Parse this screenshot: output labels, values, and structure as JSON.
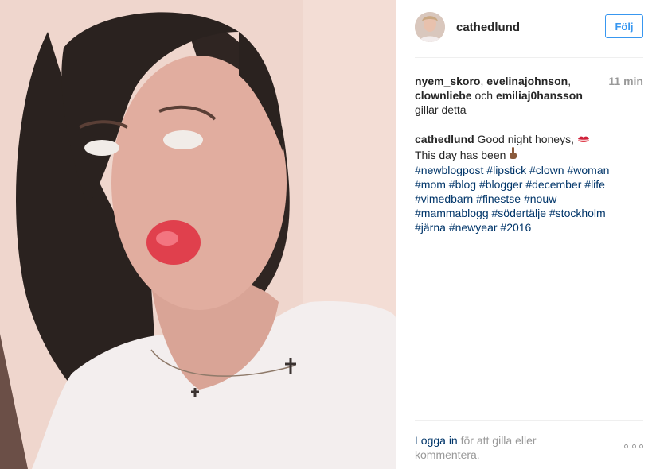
{
  "post": {
    "image_alt": "selfie-photo",
    "owner": "cathedlund",
    "follow_label": "Följ",
    "likes": {
      "users": [
        "nyem_skoro",
        "evelinajohnson",
        "clownliebe",
        "emiliaj0hansson"
      ],
      "separator": ", ",
      "conjunction": " och ",
      "suffix": "gillar detta"
    },
    "time_ago": "11 min",
    "caption": {
      "user": "cathedlund",
      "line1": " Good night honeys, ",
      "line2": "This day has been ",
      "hashtags": [
        "#newblogpost",
        "#lipstick",
        "#clown",
        "#woman",
        "#mom",
        "#blog",
        "#blogger",
        "#december",
        "#life",
        "#vimedbarn",
        "#finestse",
        "#nouw",
        "#mammablogg",
        "#södertälje",
        "#stockholm",
        "#järna",
        "#newyear",
        "#2016"
      ]
    },
    "login_link": "Logga in",
    "login_text": " för att gilla eller kommentera.",
    "more_icon": "ellipsis-icon",
    "colors": {
      "accent": "#3897f0",
      "link": "#003569",
      "muted": "#999999",
      "text": "#262626"
    }
  }
}
